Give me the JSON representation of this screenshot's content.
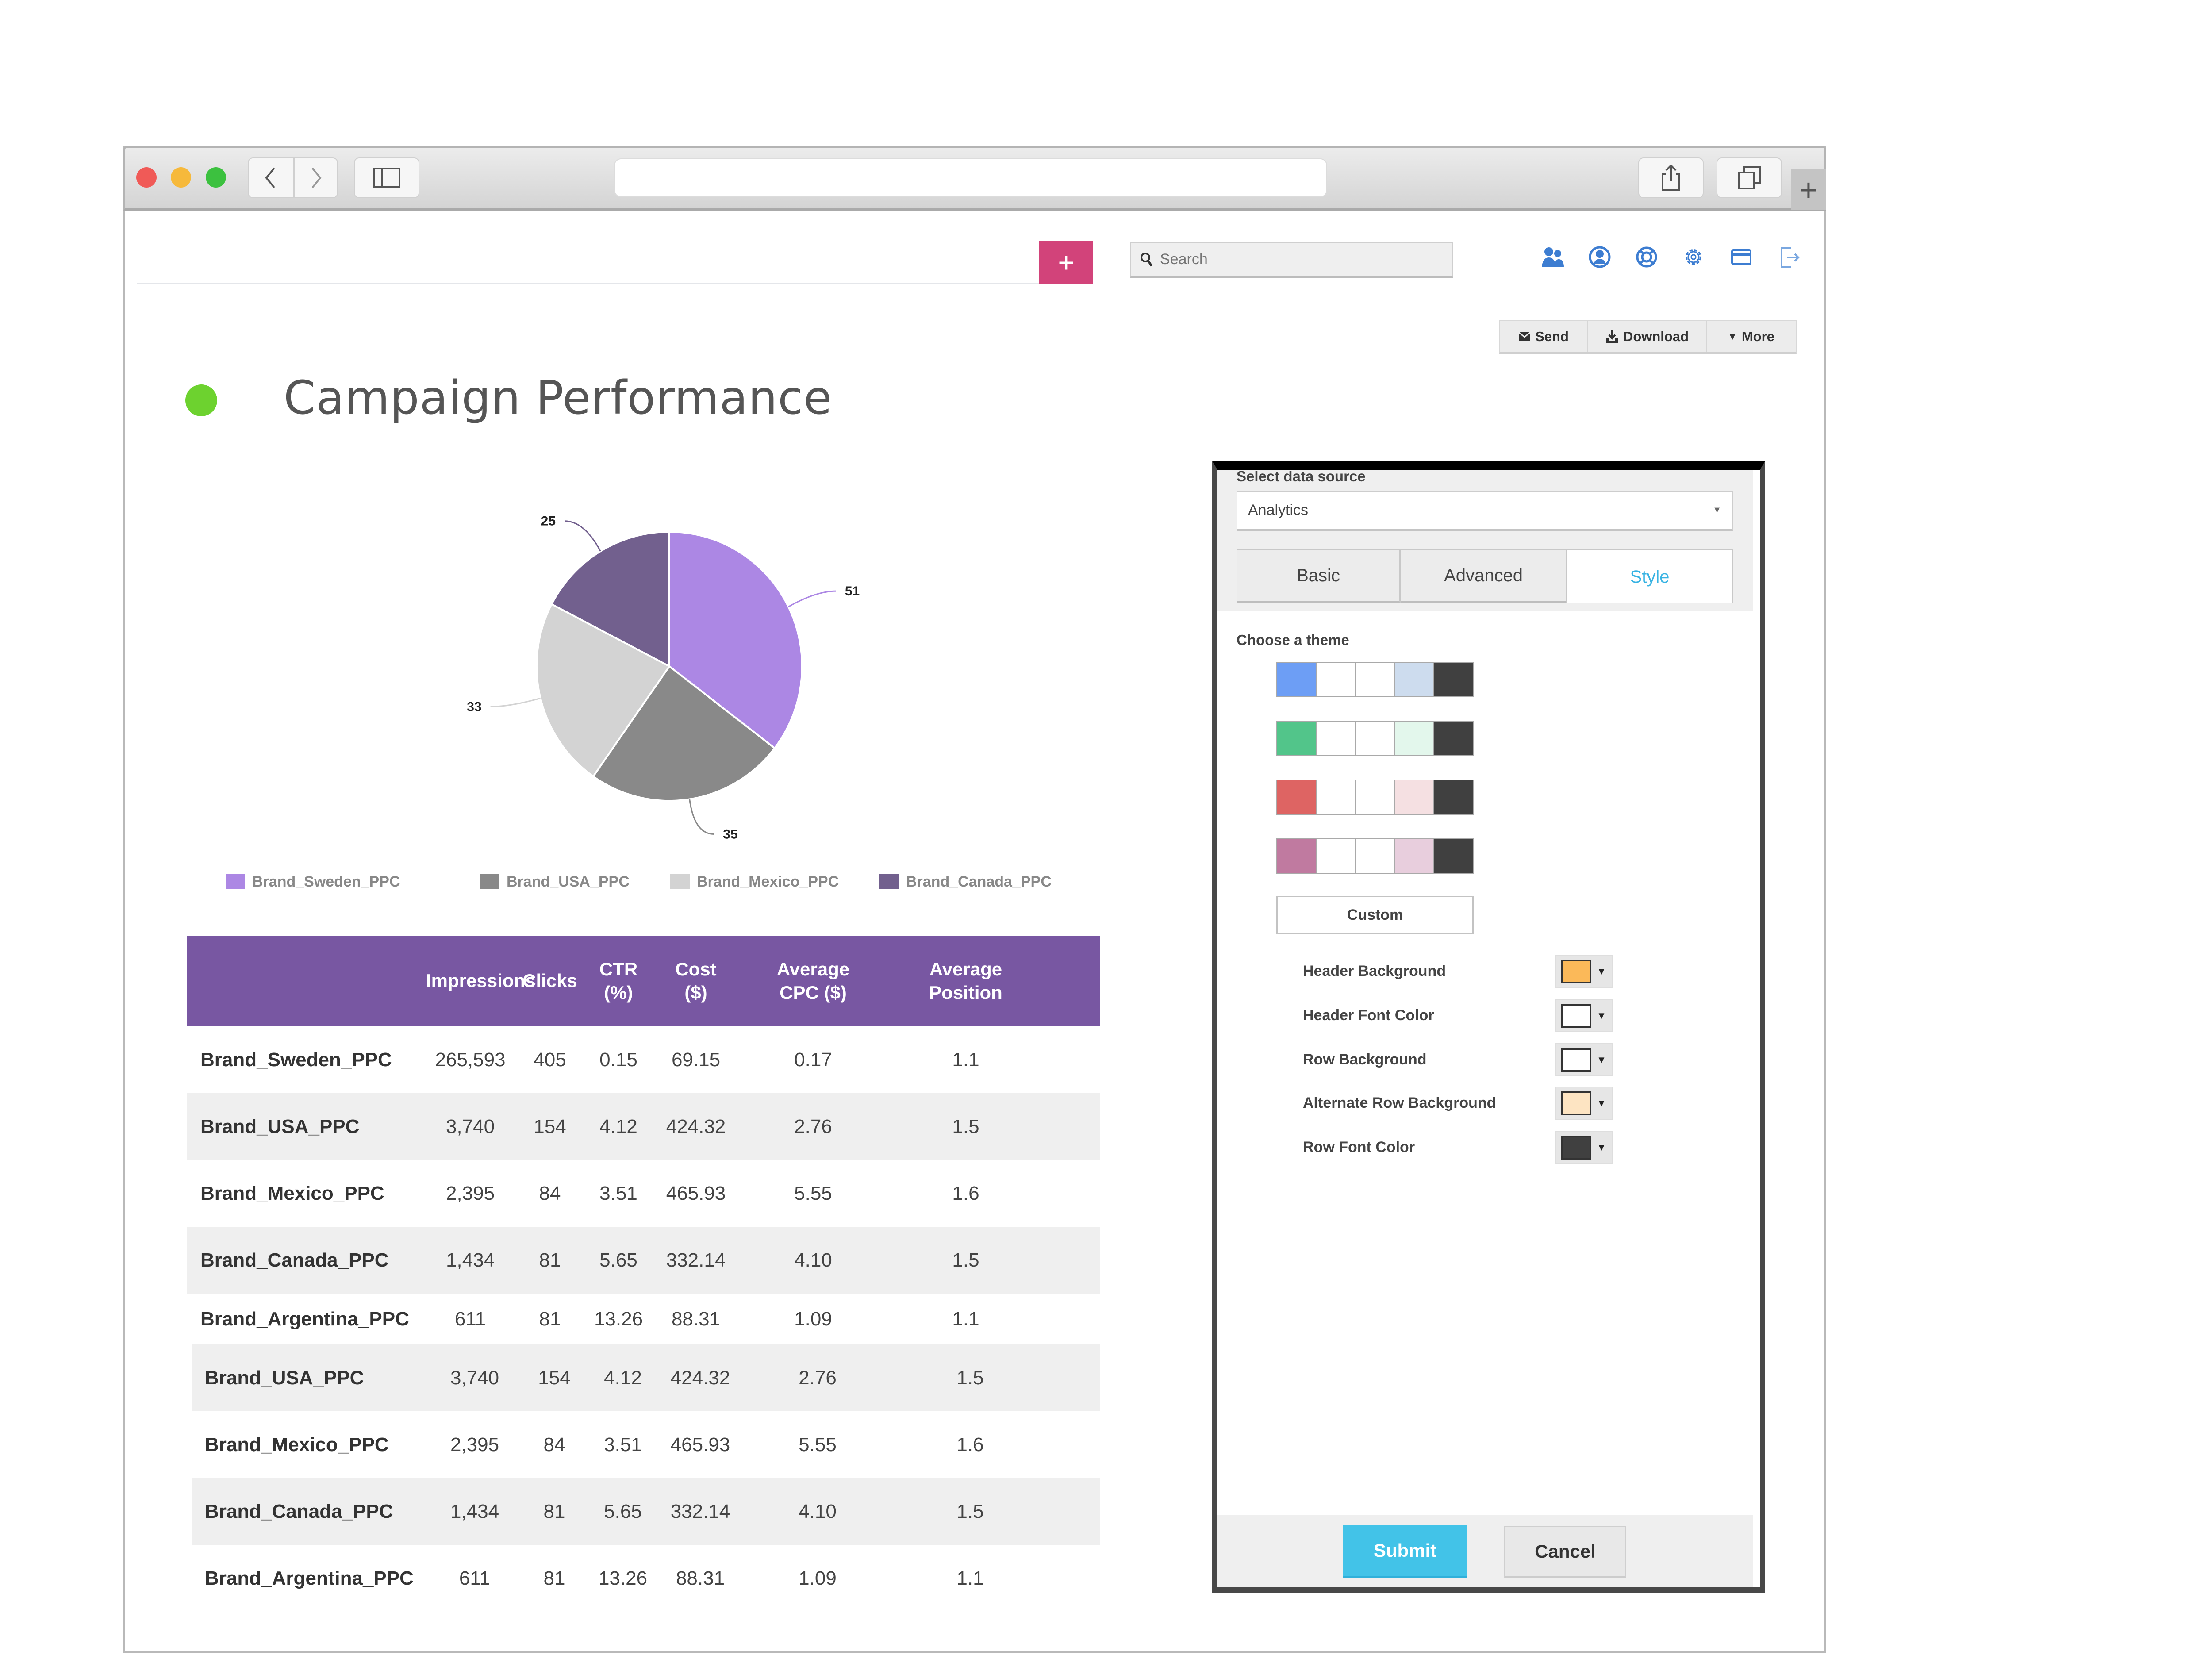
{
  "browser": {
    "url": "",
    "buttons": {
      "back": "back",
      "forward": "forward",
      "sidebar": "sidebar",
      "share": "share",
      "tabs": "tabs",
      "new_tab": "+"
    }
  },
  "header": {
    "add_label": "+",
    "search": {
      "placeholder": "Search",
      "value": ""
    },
    "icons": [
      "users-icon",
      "profile-icon",
      "help-lifebuoy-icon",
      "gear-icon",
      "credit-card-icon",
      "logout-icon"
    ],
    "icon_color": "#3d7dd1",
    "actions": [
      {
        "label": "Send",
        "icon": "envelope-icon"
      },
      {
        "label": "Download",
        "icon": "download-icon"
      },
      {
        "label": "More",
        "icon": "caret-down-icon"
      }
    ]
  },
  "page": {
    "title": "Campaign Performance",
    "status_color": "#6dd22f"
  },
  "chart_data": {
    "type": "pie",
    "title": "",
    "categories": [
      "Brand_Sweden_PPC",
      "Brand_USA_PPC",
      "Brand_Mexico_PPC",
      "Brand_Canada_PPC"
    ],
    "values": [
      51,
      35,
      33,
      25
    ],
    "colors": [
      "#ac87e4",
      "#898989",
      "#d3d3d3",
      "#72608e"
    ],
    "data_labels": [
      "51",
      "35",
      "33",
      "25"
    ],
    "legend": "bottom"
  },
  "table": {
    "header_color": "#7857a2",
    "columns": [
      {
        "lines": [
          ""
        ]
      },
      {
        "lines": [
          "Impressions"
        ]
      },
      {
        "lines": [
          "Clicks"
        ]
      },
      {
        "lines": [
          "CTR",
          "(%)"
        ]
      },
      {
        "lines": [
          "Cost",
          "($)"
        ]
      },
      {
        "lines": [
          "Average",
          "CPC ($)"
        ]
      },
      {
        "lines": [
          "Average",
          "Position"
        ]
      }
    ],
    "rows": [
      [
        "Brand_Sweden_PPC",
        "265,593",
        "405",
        "0.15",
        "69.15",
        "0.17",
        "1.1"
      ],
      [
        "Brand_USA_PPC",
        "3,740",
        "154",
        "4.12",
        "424.32",
        "2.76",
        "1.5"
      ],
      [
        "Brand_Mexico_PPC",
        "2,395",
        "84",
        "3.51",
        "465.93",
        "5.55",
        "1.6"
      ],
      [
        "Brand_Canada_PPC",
        "1,434",
        "81",
        "5.65",
        "332.14",
        "4.10",
        "1.5"
      ],
      [
        "Brand_Argentina_PPC",
        "611",
        "81",
        "13.26",
        "88.31",
        "1.09",
        "1.1"
      ],
      [
        "Brand_USA_PPC",
        "3,740",
        "154",
        "4.12",
        "424.32",
        "2.76",
        "1.5"
      ],
      [
        "Brand_Mexico_PPC",
        "2,395",
        "84",
        "3.51",
        "465.93",
        "5.55",
        "1.6"
      ],
      [
        "Brand_Canada_PPC",
        "1,434",
        "81",
        "5.65",
        "332.14",
        "4.10",
        "1.5"
      ],
      [
        "Brand_Argentina_PPC",
        "611",
        "81",
        "13.26",
        "88.31",
        "1.09",
        "1.1"
      ]
    ]
  },
  "panel": {
    "data_source_label": "Select data source",
    "data_source_value": "Analytics",
    "tabs": [
      {
        "label": "Basic",
        "active": false
      },
      {
        "label": "Advanced",
        "active": false
      },
      {
        "label": "Style",
        "active": true
      }
    ],
    "theme_label": "Choose a theme",
    "themes": [
      [
        "#6d9ef5",
        "#ffffff",
        "#ffffff",
        "#cddcee",
        "#404040"
      ],
      [
        "#52c58a",
        "#ffffff",
        "#ffffff",
        "#e3f7ec",
        "#404040"
      ],
      [
        "#de6463",
        "#ffffff",
        "#ffffff",
        "#f5e0e2",
        "#404040"
      ],
      [
        "#c07aa0",
        "#ffffff",
        "#ffffff",
        "#e8cedd",
        "#404040"
      ]
    ],
    "custom_label": "Custom",
    "color_settings": [
      {
        "label": "Header Background",
        "color": "#fbb959"
      },
      {
        "label": "Header Font Color",
        "color": "#ffffff"
      },
      {
        "label": "Row Background",
        "color": "#ffffff"
      },
      {
        "label": "Alternate Row Background",
        "color": "#fde4c2"
      },
      {
        "label": "Row Font Color",
        "color": "#404040"
      }
    ],
    "submit_label": "Submit",
    "cancel_label": "Cancel"
  }
}
